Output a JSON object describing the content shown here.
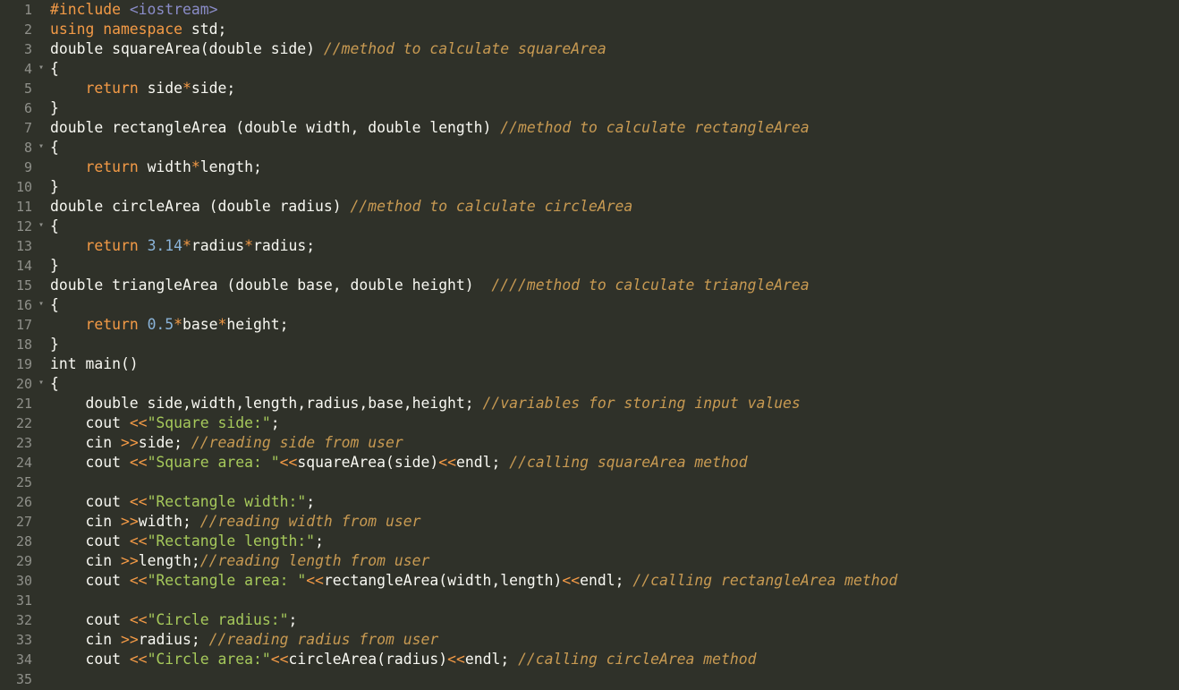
{
  "editor": {
    "colors": {
      "background": "#2f3129",
      "text": "#f8f8f2",
      "keyword": "#f39a46",
      "number": "#8ab3d8",
      "string": "#a6c95b",
      "comment": "#c89a52",
      "gutter_text": "#8f908a"
    },
    "fold_lines": [
      4,
      8,
      12,
      16,
      20
    ],
    "lines": [
      [
        {
          "t": "pre",
          "v": "#include "
        },
        {
          "t": "inc",
          "v": "<iostream>"
        }
      ],
      [
        {
          "t": "using",
          "v": "using namespace "
        },
        {
          "t": "plain",
          "v": "std;"
        }
      ],
      [
        {
          "t": "plain",
          "v": "double squareArea(double side) "
        },
        {
          "t": "cmt",
          "v": "//method to calculate squareArea"
        }
      ],
      [
        {
          "t": "plain",
          "v": "{"
        }
      ],
      [
        {
          "t": "plain",
          "v": "    "
        },
        {
          "t": "ret",
          "v": "return "
        },
        {
          "t": "plain",
          "v": "side"
        },
        {
          "t": "op",
          "v": "*"
        },
        {
          "t": "plain",
          "v": "side;"
        }
      ],
      [
        {
          "t": "plain",
          "v": "}"
        }
      ],
      [
        {
          "t": "plain",
          "v": "double rectangleArea (double width, double length) "
        },
        {
          "t": "cmt",
          "v": "//method to calculate rectangleArea"
        }
      ],
      [
        {
          "t": "plain",
          "v": "{"
        }
      ],
      [
        {
          "t": "plain",
          "v": "    "
        },
        {
          "t": "ret",
          "v": "return "
        },
        {
          "t": "plain",
          "v": "width"
        },
        {
          "t": "op",
          "v": "*"
        },
        {
          "t": "plain",
          "v": "length;"
        }
      ],
      [
        {
          "t": "plain",
          "v": "}"
        }
      ],
      [
        {
          "t": "plain",
          "v": "double circleArea (double radius) "
        },
        {
          "t": "cmt",
          "v": "//method to calculate circleArea"
        }
      ],
      [
        {
          "t": "plain",
          "v": "{"
        }
      ],
      [
        {
          "t": "plain",
          "v": "    "
        },
        {
          "t": "ret",
          "v": "return "
        },
        {
          "t": "num",
          "v": "3.14"
        },
        {
          "t": "op",
          "v": "*"
        },
        {
          "t": "plain",
          "v": "radius"
        },
        {
          "t": "op",
          "v": "*"
        },
        {
          "t": "plain",
          "v": "radius;"
        }
      ],
      [
        {
          "t": "plain",
          "v": "}"
        }
      ],
      [
        {
          "t": "plain",
          "v": "double triangleArea (double base, double height)  "
        },
        {
          "t": "cmt",
          "v": "////method to calculate triangleArea"
        }
      ],
      [
        {
          "t": "plain",
          "v": "{"
        }
      ],
      [
        {
          "t": "plain",
          "v": "    "
        },
        {
          "t": "ret",
          "v": "return "
        },
        {
          "t": "num",
          "v": "0.5"
        },
        {
          "t": "op",
          "v": "*"
        },
        {
          "t": "plain",
          "v": "base"
        },
        {
          "t": "op",
          "v": "*"
        },
        {
          "t": "plain",
          "v": "height;"
        }
      ],
      [
        {
          "t": "plain",
          "v": "}"
        }
      ],
      [
        {
          "t": "plain",
          "v": "int main()"
        }
      ],
      [
        {
          "t": "plain",
          "v": "{"
        }
      ],
      [
        {
          "t": "plain",
          "v": "    double side,width,length,radius,base,height; "
        },
        {
          "t": "cmt",
          "v": "//variables for storing input values"
        }
      ],
      [
        {
          "t": "plain",
          "v": "    cout "
        },
        {
          "t": "op",
          "v": "<<"
        },
        {
          "t": "str",
          "v": "\"Square side:\""
        },
        {
          "t": "plain",
          "v": ";"
        }
      ],
      [
        {
          "t": "plain",
          "v": "    cin "
        },
        {
          "t": "op",
          "v": ">>"
        },
        {
          "t": "plain",
          "v": "side; "
        },
        {
          "t": "cmt",
          "v": "//reading side from user"
        }
      ],
      [
        {
          "t": "plain",
          "v": "    cout "
        },
        {
          "t": "op",
          "v": "<<"
        },
        {
          "t": "str",
          "v": "\"Square area: \""
        },
        {
          "t": "op",
          "v": "<<"
        },
        {
          "t": "plain",
          "v": "squareArea(side)"
        },
        {
          "t": "op",
          "v": "<<"
        },
        {
          "t": "plain",
          "v": "endl; "
        },
        {
          "t": "cmt",
          "v": "//calling squareArea method"
        }
      ],
      [],
      [
        {
          "t": "plain",
          "v": "    cout "
        },
        {
          "t": "op",
          "v": "<<"
        },
        {
          "t": "str",
          "v": "\"Rectangle width:\""
        },
        {
          "t": "plain",
          "v": ";"
        }
      ],
      [
        {
          "t": "plain",
          "v": "    cin "
        },
        {
          "t": "op",
          "v": ">>"
        },
        {
          "t": "plain",
          "v": "width; "
        },
        {
          "t": "cmt",
          "v": "//reading width from user"
        }
      ],
      [
        {
          "t": "plain",
          "v": "    cout "
        },
        {
          "t": "op",
          "v": "<<"
        },
        {
          "t": "str",
          "v": "\"Rectangle length:\""
        },
        {
          "t": "plain",
          "v": ";"
        }
      ],
      [
        {
          "t": "plain",
          "v": "    cin "
        },
        {
          "t": "op",
          "v": ">>"
        },
        {
          "t": "plain",
          "v": "length;"
        },
        {
          "t": "cmt",
          "v": "//reading length from user"
        }
      ],
      [
        {
          "t": "plain",
          "v": "    cout "
        },
        {
          "t": "op",
          "v": "<<"
        },
        {
          "t": "str",
          "v": "\"Rectangle area: \""
        },
        {
          "t": "op",
          "v": "<<"
        },
        {
          "t": "plain",
          "v": "rectangleArea(width,length)"
        },
        {
          "t": "op",
          "v": "<<"
        },
        {
          "t": "plain",
          "v": "endl; "
        },
        {
          "t": "cmt",
          "v": "//calling rectangleArea method"
        }
      ],
      [],
      [
        {
          "t": "plain",
          "v": "    cout "
        },
        {
          "t": "op",
          "v": "<<"
        },
        {
          "t": "str",
          "v": "\"Circle radius:\""
        },
        {
          "t": "plain",
          "v": ";"
        }
      ],
      [
        {
          "t": "plain",
          "v": "    cin "
        },
        {
          "t": "op",
          "v": ">>"
        },
        {
          "t": "plain",
          "v": "radius; "
        },
        {
          "t": "cmt",
          "v": "//reading radius from user"
        }
      ],
      [
        {
          "t": "plain",
          "v": "    cout "
        },
        {
          "t": "op",
          "v": "<<"
        },
        {
          "t": "str",
          "v": "\"Circle area:\""
        },
        {
          "t": "op",
          "v": "<<"
        },
        {
          "t": "plain",
          "v": "circleArea(radius)"
        },
        {
          "t": "op",
          "v": "<<"
        },
        {
          "t": "plain",
          "v": "endl; "
        },
        {
          "t": "cmt",
          "v": "//calling circleArea method"
        }
      ],
      []
    ]
  }
}
